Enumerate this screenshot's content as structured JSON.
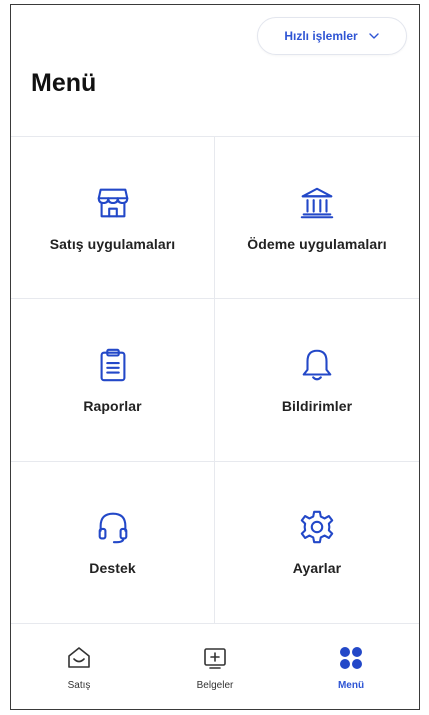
{
  "header": {
    "quick_actions_label": "Hızlı işlemler",
    "title": "Menü"
  },
  "menu": {
    "items": [
      {
        "label": "Satış uygulamaları",
        "icon": "storefront-icon"
      },
      {
        "label": "Ödeme uygulamaları",
        "icon": "bank-icon"
      },
      {
        "label": "Raporlar",
        "icon": "clipboard-icon"
      },
      {
        "label": "Bildirimler",
        "icon": "bell-icon"
      },
      {
        "label": "Destek",
        "icon": "headset-icon"
      },
      {
        "label": "Ayarlar",
        "icon": "gear-icon"
      }
    ]
  },
  "tabbar": {
    "tabs": [
      {
        "label": "Satış",
        "icon": "home-icon",
        "active": false
      },
      {
        "label": "Belgeler",
        "icon": "document-add-icon",
        "active": false
      },
      {
        "label": "Menü",
        "icon": "grid-icon",
        "active": true
      }
    ]
  },
  "colors": {
    "accent": "#2f55d4",
    "icon_blue": "#2348c8",
    "divider": "#e7e9ee"
  }
}
